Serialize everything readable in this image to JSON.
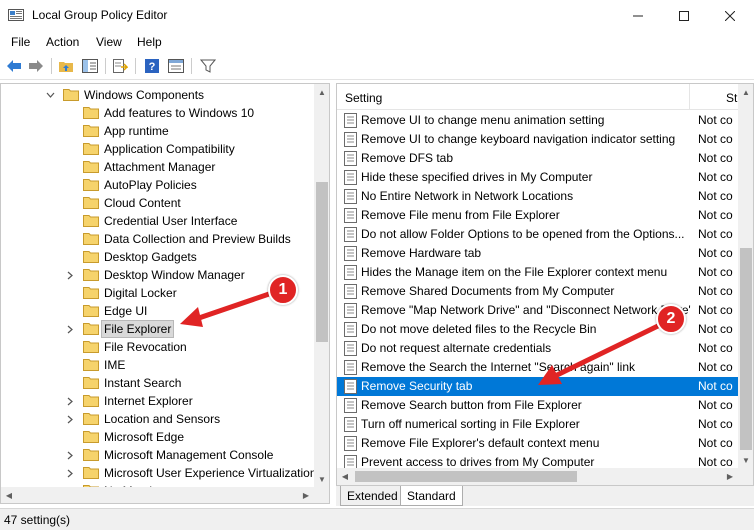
{
  "window": {
    "title": "Local Group Policy Editor",
    "minimize": "—",
    "maximize": "☐",
    "close": "✕"
  },
  "menu": [
    "File",
    "Action",
    "View",
    "Help"
  ],
  "tree": {
    "parent": "Windows Components",
    "items": [
      {
        "label": "Add features to Windows 10",
        "expandable": false
      },
      {
        "label": "App runtime",
        "expandable": false
      },
      {
        "label": "Application Compatibility",
        "expandable": false
      },
      {
        "label": "Attachment Manager",
        "expandable": false
      },
      {
        "label": "AutoPlay Policies",
        "expandable": false
      },
      {
        "label": "Cloud Content",
        "expandable": false
      },
      {
        "label": "Credential User Interface",
        "expandable": false
      },
      {
        "label": "Data Collection and Preview Builds",
        "expandable": false
      },
      {
        "label": "Desktop Gadgets",
        "expandable": false
      },
      {
        "label": "Desktop Window Manager",
        "expandable": true
      },
      {
        "label": "Digital Locker",
        "expandable": false
      },
      {
        "label": "Edge UI",
        "expandable": false
      },
      {
        "label": "File Explorer",
        "expandable": true,
        "selected": true
      },
      {
        "label": "File Revocation",
        "expandable": false
      },
      {
        "label": "IME",
        "expandable": false
      },
      {
        "label": "Instant Search",
        "expandable": false
      },
      {
        "label": "Internet Explorer",
        "expandable": true
      },
      {
        "label": "Location and Sensors",
        "expandable": true
      },
      {
        "label": "Microsoft Edge",
        "expandable": false
      },
      {
        "label": "Microsoft Management Console",
        "expandable": true
      },
      {
        "label": "Microsoft User Experience Virtualization",
        "expandable": true
      },
      {
        "label": "NetMeeting",
        "expandable": true
      }
    ]
  },
  "list": {
    "columns": {
      "setting": "Setting",
      "state": "St"
    },
    "rows": [
      {
        "name": "Remove UI to change menu animation setting",
        "state": "Not co"
      },
      {
        "name": "Remove UI to change keyboard navigation indicator setting",
        "state": "Not co"
      },
      {
        "name": "Remove DFS tab",
        "state": "Not co"
      },
      {
        "name": "Hide these specified drives in My Computer",
        "state": "Not co"
      },
      {
        "name": "No Entire Network in Network Locations",
        "state": "Not co"
      },
      {
        "name": "Remove File menu from File Explorer",
        "state": "Not co"
      },
      {
        "name": "Do not allow Folder Options to be opened from the Options...",
        "state": "Not co"
      },
      {
        "name": "Remove Hardware tab",
        "state": "Not co"
      },
      {
        "name": "Hides the Manage item on the File Explorer context menu",
        "state": "Not co"
      },
      {
        "name": "Remove Shared Documents from My Computer",
        "state": "Not co"
      },
      {
        "name": "Remove \"Map Network Drive\" and \"Disconnect Network Drive\"",
        "state": "Not co"
      },
      {
        "name": "Do not move deleted files to the Recycle Bin",
        "state": "Not co"
      },
      {
        "name": "Do not request alternate credentials",
        "state": "Not co"
      },
      {
        "name": "Remove the Search the Internet \"Search again\" link",
        "state": "Not co"
      },
      {
        "name": "Remove Security tab",
        "state": "Not co",
        "selected": true
      },
      {
        "name": "Remove Search button from File Explorer",
        "state": "Not co"
      },
      {
        "name": "Turn off numerical sorting in File Explorer",
        "state": "Not co"
      },
      {
        "name": "Remove File Explorer's default context menu",
        "state": "Not co"
      },
      {
        "name": "Prevent access to drives from My Computer",
        "state": "Not co"
      }
    ]
  },
  "tabs": [
    "Extended",
    "Standard"
  ],
  "active_tab": "Standard",
  "status": "47 setting(s)",
  "annotations": {
    "callout_1": "1",
    "callout_2": "2",
    "color": "#e02424"
  },
  "colors": {
    "selection": "#0078d7",
    "folder": "#f3c843"
  }
}
